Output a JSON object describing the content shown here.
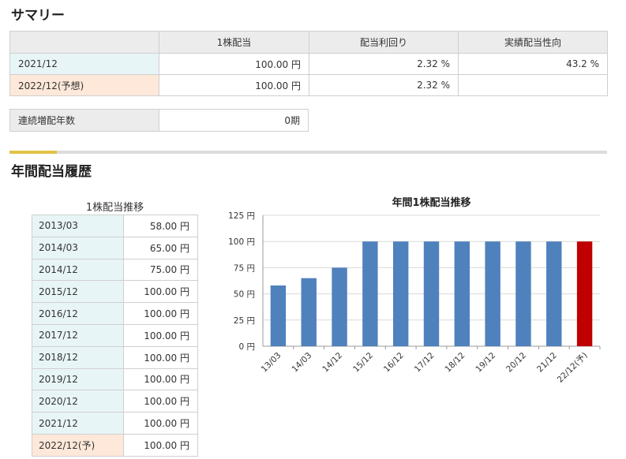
{
  "summary": {
    "title": "サマリー",
    "headers": [
      "1株配当",
      "配当利回り",
      "実績配当性向"
    ],
    "rows": [
      {
        "label": "2021/12",
        "dividend": "100.00 円",
        "yield": "2.32 %",
        "payout": "43.2 %"
      },
      {
        "label": "2022/12(予想)",
        "dividend": "100.00 円",
        "yield": "2.32 %",
        "payout": ""
      }
    ],
    "streak_label": "連続増配年数",
    "streak_value": "0期"
  },
  "history": {
    "title": "年間配当履歴",
    "table_caption": "1株配当推移",
    "rows": [
      {
        "period": "2013/03",
        "value": "58.00 円"
      },
      {
        "period": "2014/03",
        "value": "65.00 円"
      },
      {
        "period": "2014/12",
        "value": "75.00 円"
      },
      {
        "period": "2015/12",
        "value": "100.00 円"
      },
      {
        "period": "2016/12",
        "value": "100.00 円"
      },
      {
        "period": "2017/12",
        "value": "100.00 円"
      },
      {
        "period": "2018/12",
        "value": "100.00 円"
      },
      {
        "period": "2019/12",
        "value": "100.00 円"
      },
      {
        "period": "2020/12",
        "value": "100.00 円"
      },
      {
        "period": "2021/12",
        "value": "100.00 円"
      },
      {
        "period": "2022/12(予)",
        "value": "100.00 円"
      }
    ]
  },
  "colors": {
    "bar": "#4f81bd",
    "bar_forecast": "#c00000",
    "label_blue": "#e8f5f7",
    "label_peach": "#fde8d9",
    "accent": "#e3c247"
  },
  "chart_data": {
    "type": "bar",
    "title": "年間1株配当推移",
    "categories": [
      "13/03",
      "14/03",
      "14/12",
      "15/12",
      "16/12",
      "17/12",
      "18/12",
      "19/12",
      "20/12",
      "21/12",
      "22/12(予)"
    ],
    "values": [
      58,
      65,
      75,
      100,
      100,
      100,
      100,
      100,
      100,
      100,
      100
    ],
    "forecast_index": 10,
    "ylim": [
      0,
      125
    ],
    "yticks": [
      0,
      25,
      50,
      75,
      100,
      125
    ],
    "ytick_suffix": " 円",
    "grid": true,
    "xlabel": "",
    "ylabel": ""
  }
}
